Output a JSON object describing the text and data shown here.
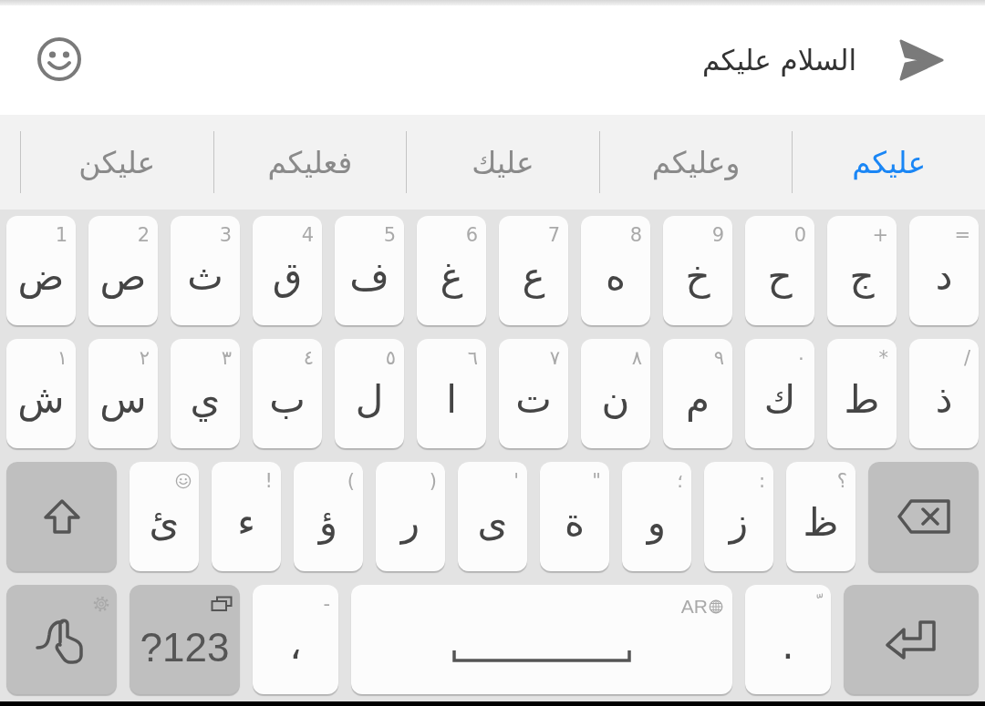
{
  "compose": {
    "message": "السلام عليكم"
  },
  "suggestions": [
    {
      "text": "عليكم",
      "selected": true
    },
    {
      "text": "وعليكم",
      "selected": false
    },
    {
      "text": "عليك",
      "selected": false
    },
    {
      "text": "فعليكم",
      "selected": false
    },
    {
      "text": "عليكن",
      "selected": false
    }
  ],
  "keyboard": {
    "rows": [
      {
        "keys": [
          {
            "kind": "letter",
            "label": "د",
            "hint": "="
          },
          {
            "kind": "letter",
            "label": "ج",
            "hint": "+"
          },
          {
            "kind": "letter",
            "label": "ح",
            "hint": "0"
          },
          {
            "kind": "letter",
            "label": "خ",
            "hint": "9"
          },
          {
            "kind": "letter",
            "label": "ه",
            "hint": "8"
          },
          {
            "kind": "letter",
            "label": "ع",
            "hint": "7"
          },
          {
            "kind": "letter",
            "label": "غ",
            "hint": "6"
          },
          {
            "kind": "letter",
            "label": "ف",
            "hint": "5"
          },
          {
            "kind": "letter",
            "label": "ق",
            "hint": "4"
          },
          {
            "kind": "letter",
            "label": "ث",
            "hint": "3"
          },
          {
            "kind": "letter",
            "label": "ص",
            "hint": "2"
          },
          {
            "kind": "letter",
            "label": "ض",
            "hint": "1"
          }
        ]
      },
      {
        "keys": [
          {
            "kind": "letter",
            "label": "ذ",
            "hint": "/"
          },
          {
            "kind": "letter",
            "label": "ط",
            "hint": "*"
          },
          {
            "kind": "letter",
            "label": "ك",
            "hint": "٠"
          },
          {
            "kind": "letter",
            "label": "م",
            "hint": "٩"
          },
          {
            "kind": "letter",
            "label": "ن",
            "hint": "٨"
          },
          {
            "kind": "letter",
            "label": "ت",
            "hint": "٧"
          },
          {
            "kind": "letter",
            "label": "ا",
            "hint": "٦"
          },
          {
            "kind": "letter",
            "label": "ل",
            "hint": "٥"
          },
          {
            "kind": "letter",
            "label": "ب",
            "hint": "٤"
          },
          {
            "kind": "letter",
            "label": "ي",
            "hint": "٣"
          },
          {
            "kind": "letter",
            "label": "س",
            "hint": "٢"
          },
          {
            "kind": "letter",
            "label": "ش",
            "hint": "١"
          }
        ]
      },
      {
        "keys": [
          {
            "kind": "backspace"
          },
          {
            "kind": "letter",
            "label": "ظ",
            "hint": "؟"
          },
          {
            "kind": "letter",
            "label": "ز",
            "hint": ":"
          },
          {
            "kind": "letter",
            "label": "و",
            "hint": "؛"
          },
          {
            "kind": "letter",
            "label": "ة",
            "hint": "\""
          },
          {
            "kind": "letter",
            "label": "ى",
            "hint": "'"
          },
          {
            "kind": "letter",
            "label": "ر",
            "hint": ")"
          },
          {
            "kind": "letter",
            "label": "ؤ",
            "hint": "("
          },
          {
            "kind": "letter",
            "label": "ء",
            "hint": "!"
          },
          {
            "kind": "emoji_letter",
            "label": "ئ"
          },
          {
            "kind": "shift"
          }
        ]
      },
      {
        "keys": [
          {
            "kind": "enter"
          },
          {
            "kind": "letter",
            "label": ".",
            "hint": "ﹼ"
          },
          {
            "kind": "space",
            "language": "AR"
          },
          {
            "kind": "letter",
            "label": "،",
            "hint": "-"
          },
          {
            "kind": "symbols",
            "label": "?123"
          },
          {
            "kind": "gesture"
          }
        ]
      }
    ]
  }
}
